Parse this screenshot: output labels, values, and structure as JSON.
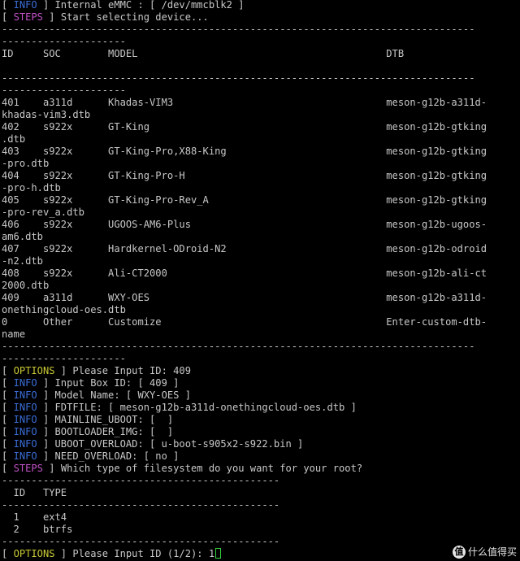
{
  "lines": [
    {
      "kind": "tag",
      "tag": "INFO",
      "text": "Internal eMMC : [ /dev/mmcblk2 ]"
    },
    {
      "kind": "tag",
      "tag": "STEPS",
      "text": "Start selecting device..."
    },
    {
      "kind": "rule",
      "text": "--------------------------------------------------------------------------------"
    },
    {
      "kind": "rule",
      "text": "---------------------"
    },
    {
      "kind": "text",
      "text": "ID     SOC        MODEL                                          DTB"
    },
    {
      "kind": "text",
      "text": ""
    },
    {
      "kind": "rule",
      "text": "--------------------------------------------------------------------------------"
    },
    {
      "kind": "rule",
      "text": "---------------------"
    },
    {
      "kind": "text",
      "text": "401    a311d      Khadas-VIM3                                    meson-g12b-a311d-"
    },
    {
      "kind": "text",
      "text": "khadas-vim3.dtb"
    },
    {
      "kind": "text",
      "text": "402    s922x      GT-King                                        meson-g12b-gtking"
    },
    {
      "kind": "text",
      "text": ".dtb"
    },
    {
      "kind": "text",
      "text": "403    s922x      GT-King-Pro,X88-King                           meson-g12b-gtking"
    },
    {
      "kind": "text",
      "text": "-pro.dtb"
    },
    {
      "kind": "text",
      "text": "404    s922x      GT-King-Pro-H                                  meson-g12b-gtking"
    },
    {
      "kind": "text",
      "text": "-pro-h.dtb"
    },
    {
      "kind": "text",
      "text": "405    s922x      GT-King-Pro-Rev_A                              meson-g12b-gtking"
    },
    {
      "kind": "text",
      "text": "-pro-rev_a.dtb"
    },
    {
      "kind": "text",
      "text": "406    s922x      UGOOS-AM6-Plus                                 meson-g12b-ugoos-"
    },
    {
      "kind": "text",
      "text": "am6.dtb"
    },
    {
      "kind": "text",
      "text": "407    s922x      Hardkernel-ODroid-N2                           meson-g12b-odroid"
    },
    {
      "kind": "text",
      "text": "-n2.dtb"
    },
    {
      "kind": "text",
      "text": "408    s922x      Ali-CT2000                                     meson-g12b-ali-ct"
    },
    {
      "kind": "text",
      "text": "2000.dtb"
    },
    {
      "kind": "text",
      "text": "409    a311d      WXY-OES                                        meson-g12b-a311d-"
    },
    {
      "kind": "text",
      "text": "onethingcloud-oes.dtb"
    },
    {
      "kind": "text",
      "text": "0      Other      Customize                                      Enter-custom-dtb-"
    },
    {
      "kind": "text",
      "text": "name"
    },
    {
      "kind": "rule",
      "text": "--------------------------------------------------------------------------------"
    },
    {
      "kind": "rule",
      "text": "---------------------"
    },
    {
      "kind": "tag",
      "tag": "OPTIONS",
      "text": "Please Input ID: 409"
    },
    {
      "kind": "tag",
      "tag": "INFO",
      "text": "Input Box ID: [ 409 ]"
    },
    {
      "kind": "tag",
      "tag": "INFO",
      "text": "Model Name: [ WXY-OES ]"
    },
    {
      "kind": "tag",
      "tag": "INFO",
      "text": "FDTFILE: [ meson-g12b-a311d-onethingcloud-oes.dtb ]"
    },
    {
      "kind": "tag",
      "tag": "INFO",
      "text": "MAINLINE_UBOOT: [  ]"
    },
    {
      "kind": "tag",
      "tag": "INFO",
      "text": "BOOTLOADER_IMG: [  ]"
    },
    {
      "kind": "tag",
      "tag": "INFO",
      "text": "UBOOT_OVERLOAD: [ u-boot-s905x2-s922.bin ]"
    },
    {
      "kind": "tag",
      "tag": "INFO",
      "text": "NEED_OVERLOAD: [ no ]"
    },
    {
      "kind": "tag",
      "tag": "STEPS",
      "text": "Which type of filesystem do you want for your root?"
    },
    {
      "kind": "rule",
      "text": "-----------------------------------------------"
    },
    {
      "kind": "text",
      "text": "  ID   TYPE"
    },
    {
      "kind": "rule",
      "text": "-----------------------------------------------"
    },
    {
      "kind": "text",
      "text": "  1    ext4"
    },
    {
      "kind": "text",
      "text": "  2    btrfs"
    },
    {
      "kind": "rule",
      "text": "-----------------------------------------------"
    },
    {
      "kind": "prompt",
      "tag": "OPTIONS",
      "text": "Please Input ID (1/2): 1"
    }
  ],
  "watermark": {
    "logo": "值",
    "text": "什么值得买"
  },
  "colors": {
    "background": "#000000",
    "foreground": "#c8c8c8",
    "info": "#3b6ed8",
    "steps": "#c152c8",
    "options": "#c9c936",
    "cursor": "#2fd33a"
  }
}
